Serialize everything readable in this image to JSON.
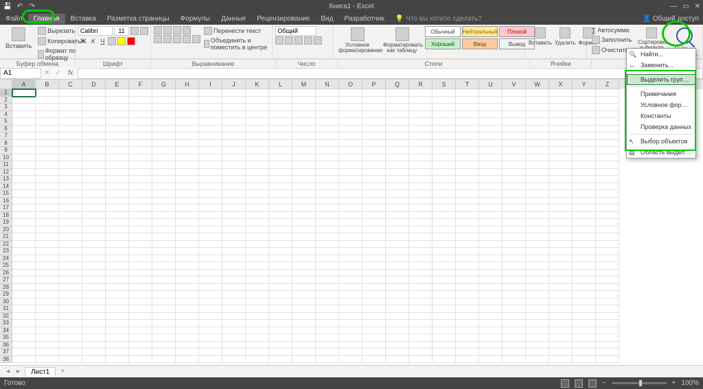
{
  "title": "Книга1 - Excel",
  "share": "Общий доступ",
  "tell_me": "Что вы хотите сделать?",
  "tabs": {
    "file": "Файл",
    "home": "Главная",
    "insert": "Вставка",
    "page_layout": "Разметка страницы",
    "formulas": "Формулы",
    "data": "Данные",
    "review": "Рецензирование",
    "view": "Вид",
    "developer": "Разработчик"
  },
  "ribbon": {
    "paste": "Вставить",
    "clipboard": {
      "cut": "Вырезать",
      "copy": "Копировать",
      "format_painter": "Формат по образцу",
      "label": "Буфер обмена"
    },
    "font": {
      "name": "Calibri",
      "size": "11",
      "label": "Шрифт"
    },
    "alignment": {
      "wrap": "Перенести текст",
      "merge": "Объединить и поместить в центре",
      "label": "Выравнивание"
    },
    "number": {
      "format": "Общий",
      "label": "Число"
    },
    "styles": {
      "conditional": "Условное форматирование",
      "as_table": "Форматировать как таблицу",
      "label": "Стили",
      "normal": "Обычный",
      "neutral": "Нейтральный",
      "bad": "Плохой",
      "good": "Хороший",
      "input": "Ввод",
      "output": "Вывод"
    },
    "cells": {
      "insert": "Вставить",
      "delete": "Удалить",
      "format": "Формат",
      "label": "Ячейки"
    },
    "editing": {
      "autosum": "Автосумма",
      "fill": "Заполнить",
      "clear": "Очистить",
      "sort": "Сортировка и фильтр",
      "find": "Найти и выделить"
    }
  },
  "name_box": "A1",
  "sheet": {
    "tab1": "Лист1",
    "add": "+"
  },
  "status": {
    "ready": "Готово",
    "zoom": "100%"
  },
  "cols": [
    "A",
    "B",
    "C",
    "D",
    "E",
    "F",
    "G",
    "H",
    "I",
    "J",
    "K",
    "L",
    "M",
    "N",
    "O",
    "P",
    "Q",
    "R",
    "S",
    "T",
    "U",
    "V",
    "W",
    "X",
    "Y",
    "Z"
  ],
  "menu": {
    "find": "Найти...",
    "replace": "Заменить...",
    "goto_special": "Выделить группу ячеек...",
    "comments": "Примечания",
    "cond_format": "Условное форматирование",
    "constants": "Константы",
    "validation": "Проверка данных",
    "select_objects": "Выбор объектов",
    "selection_pane": "Область выделения..."
  }
}
